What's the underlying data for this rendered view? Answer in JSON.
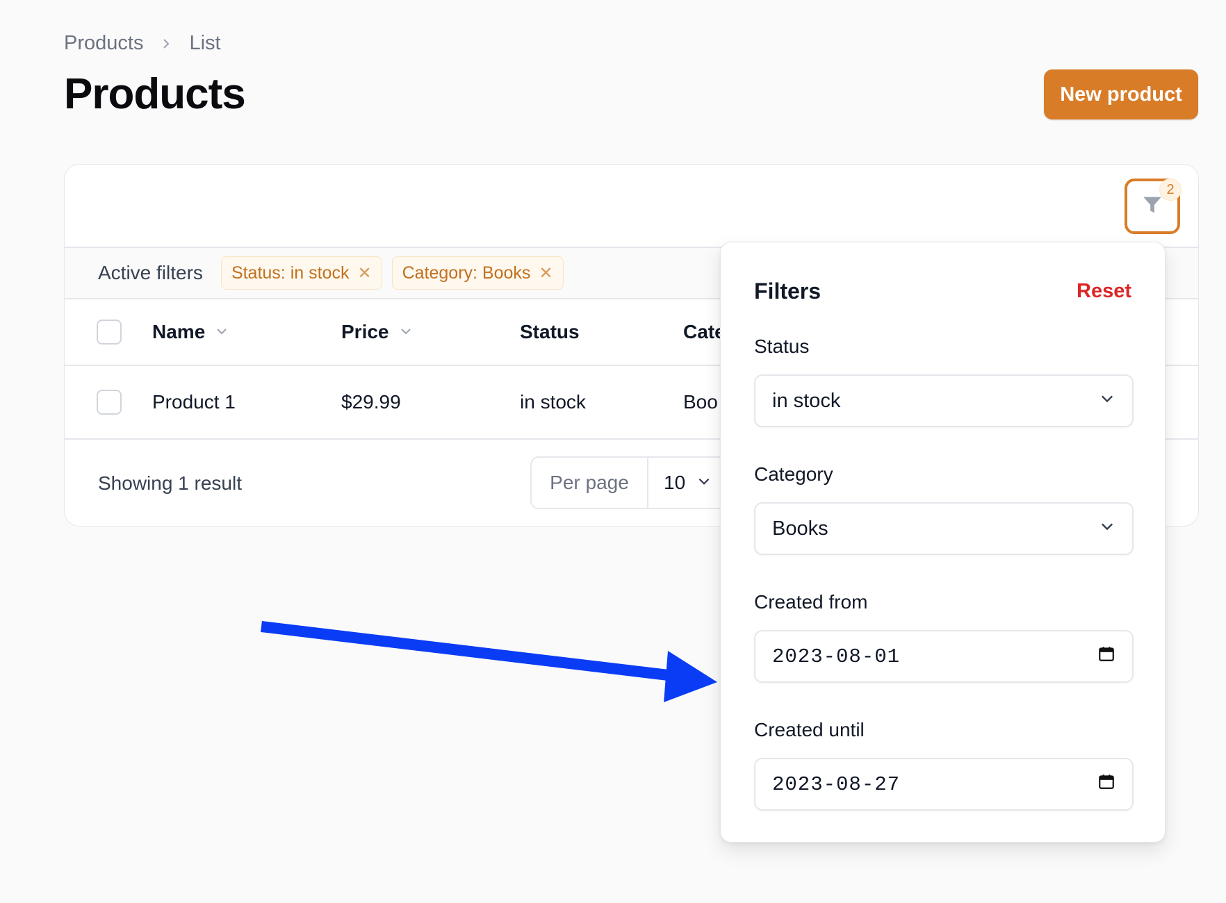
{
  "breadcrumb": {
    "items": [
      "Products",
      "List"
    ]
  },
  "page": {
    "title": "Products",
    "new_button": "New product"
  },
  "toolbar": {
    "filter_count": "2"
  },
  "active_filters": {
    "label": "Active filters",
    "chips": [
      "Status: in stock",
      "Category: Books"
    ]
  },
  "table": {
    "columns": [
      "Name",
      "Price",
      "Status",
      "Cate"
    ],
    "rows": [
      {
        "name": "Product 1",
        "price": "$29.99",
        "status": "in stock",
        "category": "Boo"
      }
    ]
  },
  "footer": {
    "showing": "Showing 1 result",
    "per_page_label": "Per page",
    "per_page_value": "10"
  },
  "filters_panel": {
    "title": "Filters",
    "reset": "Reset",
    "status": {
      "label": "Status",
      "value": "in stock"
    },
    "category": {
      "label": "Category",
      "value": "Books"
    },
    "created_from": {
      "label": "Created from",
      "value": "2023-08-01"
    },
    "created_until": {
      "label": "Created until",
      "value": "2023-08-27"
    }
  },
  "colors": {
    "accent": "#d97c28",
    "danger": "#dc2626",
    "annotation_arrow": "#0a3cf5"
  },
  "icons": [
    "chevron-right-icon",
    "filter-icon",
    "close-icon",
    "chevron-down-icon",
    "calendar-icon"
  ]
}
